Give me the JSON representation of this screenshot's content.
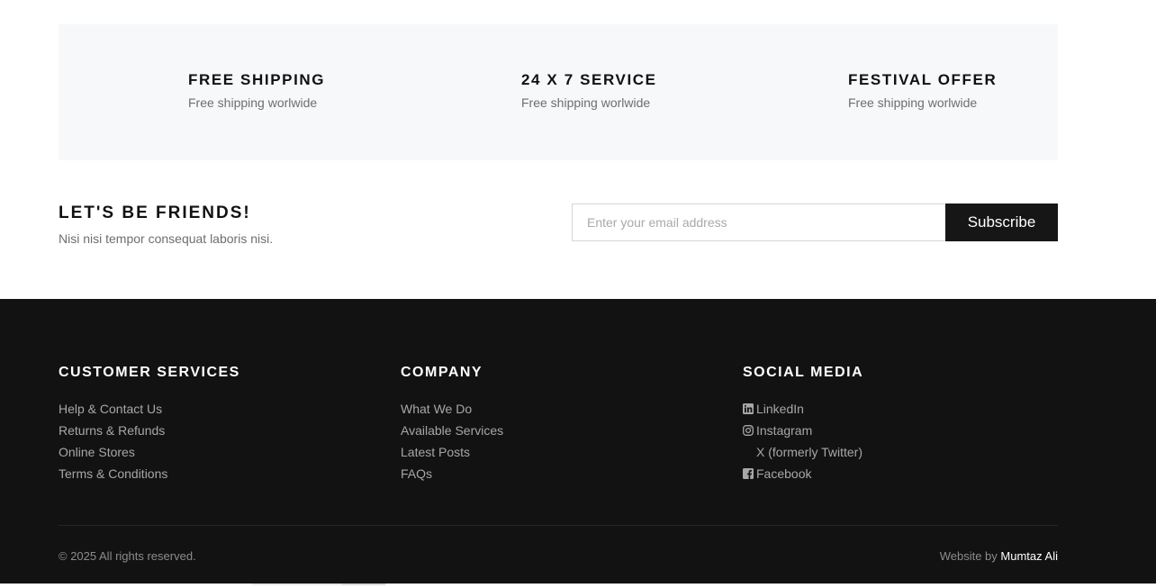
{
  "features": [
    {
      "title": "FREE SHIPPING",
      "subtitle": "Free shipping worlwide"
    },
    {
      "title": "24 X 7 SERVICE",
      "subtitle": "Free shipping worlwide"
    },
    {
      "title": "FESTIVAL OFFER",
      "subtitle": "Free shipping worlwide"
    }
  ],
  "newsletter": {
    "title": "LET'S BE FRIENDS!",
    "subtitle": "Nisi nisi tempor consequat laboris nisi.",
    "email_placeholder": "Enter your email address",
    "button_label": "Subscribe"
  },
  "footer": {
    "customer_services": {
      "title": "CUSTOMER SERVICES",
      "links": [
        "Help & Contact Us",
        "Returns & Refunds",
        "Online Stores",
        "Terms & Conditions"
      ]
    },
    "company": {
      "title": "COMPANY",
      "links": [
        "What We Do",
        "Available Services",
        "Latest Posts",
        "FAQs"
      ]
    },
    "social_media": {
      "title": "SOCIAL MEDIA",
      "links": [
        {
          "label": "LinkedIn",
          "icon": "linkedin-icon"
        },
        {
          "label": "Instagram",
          "icon": "instagram-icon"
        },
        {
          "label": "X (formerly Twitter)",
          "icon": "x-icon"
        },
        {
          "label": "Facebook",
          "icon": "facebook-icon"
        }
      ]
    },
    "copyright": "© 2025 All rights reserved.",
    "credit_prefix": "Website by",
    "credit_name": "Mumtaz Ali"
  },
  "colors": {
    "feature_bg": "#f7f8f9",
    "footer_bg": "#121212",
    "button_bg": "#161616",
    "link_color": "#a7a7a7"
  }
}
